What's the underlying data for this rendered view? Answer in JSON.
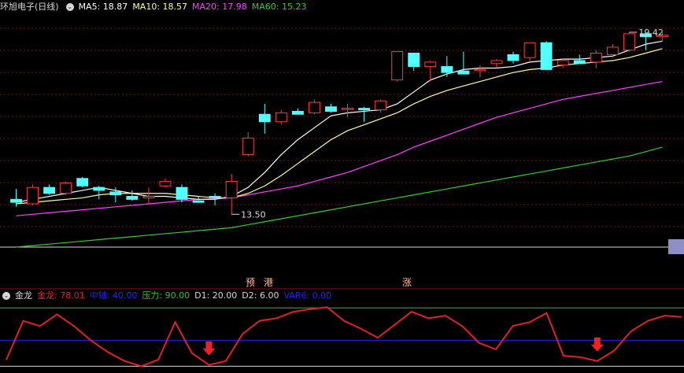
{
  "colors": {
    "bg": "#000000",
    "up": "#ff3b3b",
    "down": "#54ffff",
    "ma5": "#ffffff",
    "ma10": "#ffff99",
    "ma20": "#ff40ff",
    "ma60": "#33cc33",
    "gold": "#dd2222",
    "mid": "#2222ee",
    "press": "#33bb33",
    "grid": "#7a1414",
    "white": "#d8d8d8",
    "signal": "#ffb6a0"
  },
  "main_header": {
    "title": "环旭电子(日线)",
    "ma5": "MA5: 18.87",
    "ma10": "MA10: 18.57",
    "ma20": "MA20: 17.98",
    "ma60": "MA60: 15.23"
  },
  "ind_header": {
    "name": "金龙",
    "jinlong": "金龙: 78.01",
    "zhongzhou": "中轴: 40.00",
    "yali": "压力: 90.00",
    "d1": "D1: 20.00",
    "d2": "D2: 6.00",
    "var6": "VAR6: 0.00"
  },
  "signals": [
    "预",
    "港",
    "涨"
  ],
  "chart_data": [
    {
      "type": "candlestick",
      "title": "环旭电子(日线)",
      "y_range": [
        12.5,
        20.2
      ],
      "high_label": "19.42",
      "low_label": "13.50",
      "candles": [
        {
          "o": 14.1,
          "h": 14.45,
          "l": 13.85,
          "c": 14.0
        },
        {
          "o": 13.95,
          "h": 14.6,
          "l": 13.9,
          "c": 14.5
        },
        {
          "o": 14.5,
          "h": 14.6,
          "l": 14.25,
          "c": 14.3
        },
        {
          "o": 14.3,
          "h": 14.7,
          "l": 14.25,
          "c": 14.65
        },
        {
          "o": 14.8,
          "h": 14.85,
          "l": 14.5,
          "c": 14.55
        },
        {
          "o": 14.5,
          "h": 14.55,
          "l": 14.1,
          "c": 14.4
        },
        {
          "o": 14.35,
          "h": 14.5,
          "l": 14.0,
          "c": 14.25
        },
        {
          "o": 14.2,
          "h": 14.4,
          "l": 14.05,
          "c": 14.1
        },
        {
          "o": 14.15,
          "h": 14.5,
          "l": 13.95,
          "c": 14.2
        },
        {
          "o": 14.55,
          "h": 14.8,
          "l": 14.5,
          "c": 14.7
        },
        {
          "o": 14.5,
          "h": 14.6,
          "l": 14.0,
          "c": 14.1
        },
        {
          "o": 14.05,
          "h": 14.2,
          "l": 14.0,
          "c": 14.0
        },
        {
          "o": 14.2,
          "h": 14.3,
          "l": 13.9,
          "c": 14.15
        },
        {
          "o": 14.15,
          "h": 14.95,
          "l": 13.6,
          "c": 14.7
        },
        {
          "o": 15.6,
          "h": 16.35,
          "l": 15.55,
          "c": 16.15
        },
        {
          "o": 16.95,
          "h": 17.3,
          "l": 16.3,
          "c": 16.7
        },
        {
          "o": 16.7,
          "h": 17.1,
          "l": 16.6,
          "c": 17.0
        },
        {
          "o": 17.05,
          "h": 17.15,
          "l": 16.95,
          "c": 16.95
        },
        {
          "o": 17.0,
          "h": 17.45,
          "l": 16.95,
          "c": 17.35
        },
        {
          "o": 17.2,
          "h": 17.3,
          "l": 17.0,
          "c": 17.05
        },
        {
          "o": 17.15,
          "h": 17.3,
          "l": 16.85,
          "c": 17.15
        },
        {
          "o": 17.15,
          "h": 17.2,
          "l": 16.7,
          "c": 17.1
        },
        {
          "o": 17.1,
          "h": 17.45,
          "l": 17.0,
          "c": 17.4
        },
        {
          "o": 18.1,
          "h": 19.05,
          "l": 18.05,
          "c": 19.05
        },
        {
          "o": 19.0,
          "h": 19.0,
          "l": 18.4,
          "c": 18.55
        },
        {
          "o": 18.55,
          "h": 18.75,
          "l": 18.05,
          "c": 18.7
        },
        {
          "o": 18.55,
          "h": 18.9,
          "l": 18.2,
          "c": 18.35
        },
        {
          "o": 18.4,
          "h": 19.05,
          "l": 18.3,
          "c": 18.3
        },
        {
          "o": 18.45,
          "h": 18.6,
          "l": 18.2,
          "c": 18.45
        },
        {
          "o": 18.65,
          "h": 18.8,
          "l": 18.5,
          "c": 18.75
        },
        {
          "o": 18.95,
          "h": 19.05,
          "l": 18.65,
          "c": 18.75
        },
        {
          "o": 18.85,
          "h": 19.35,
          "l": 18.75,
          "c": 19.35
        },
        {
          "o": 19.35,
          "h": 19.4,
          "l": 18.45,
          "c": 18.45
        },
        {
          "o": 18.6,
          "h": 18.8,
          "l": 18.5,
          "c": 18.75
        },
        {
          "o": 18.75,
          "h": 18.95,
          "l": 18.65,
          "c": 18.65
        },
        {
          "o": 18.7,
          "h": 19.1,
          "l": 18.5,
          "c": 19.0
        },
        {
          "o": 18.95,
          "h": 19.3,
          "l": 18.85,
          "c": 19.2
        },
        {
          "o": 19.1,
          "h": 19.7,
          "l": 19.05,
          "c": 19.65
        },
        {
          "o": 19.65,
          "h": 19.7,
          "l": 19.1,
          "c": 19.55
        },
        {
          "o": 19.55,
          "h": 19.7,
          "l": 19.4,
          "c": 19.6
        }
      ],
      "ma5": [
        14.0,
        14.1,
        14.2,
        14.3,
        14.4,
        14.5,
        14.4,
        14.3,
        14.2,
        14.2,
        14.15,
        14.1,
        14.1,
        14.2,
        14.5,
        15.0,
        15.6,
        16.1,
        16.5,
        16.9,
        17.0,
        17.05,
        17.1,
        17.3,
        17.7,
        18.1,
        18.3,
        18.45,
        18.5,
        18.5,
        18.55,
        18.7,
        18.75,
        18.8,
        18.8,
        18.85,
        18.9,
        19.1,
        19.3,
        19.4
      ],
      "ma10": [
        13.95,
        14.0,
        14.05,
        14.1,
        14.15,
        14.25,
        14.3,
        14.3,
        14.3,
        14.3,
        14.25,
        14.2,
        14.15,
        14.15,
        14.3,
        14.55,
        14.9,
        15.3,
        15.7,
        16.1,
        16.4,
        16.6,
        16.8,
        17.0,
        17.3,
        17.55,
        17.75,
        17.9,
        18.05,
        18.2,
        18.35,
        18.45,
        18.5,
        18.6,
        18.65,
        18.7,
        18.75,
        18.85,
        19.0,
        19.15
      ],
      "ma20": [
        13.55,
        13.6,
        13.65,
        13.7,
        13.75,
        13.8,
        13.85,
        13.9,
        13.95,
        14.0,
        14.05,
        14.1,
        14.12,
        14.15,
        14.25,
        14.35,
        14.45,
        14.55,
        14.7,
        14.85,
        15.0,
        15.2,
        15.4,
        15.6,
        15.85,
        16.05,
        16.25,
        16.45,
        16.65,
        16.85,
        17.0,
        17.15,
        17.3,
        17.45,
        17.55,
        17.65,
        17.75,
        17.85,
        17.95,
        18.05
      ],
      "ma60": [
        12.5,
        12.55,
        12.6,
        12.65,
        12.7,
        12.75,
        12.8,
        12.85,
        12.9,
        12.95,
        13.0,
        13.05,
        13.1,
        13.15,
        13.25,
        13.35,
        13.45,
        13.55,
        13.65,
        13.75,
        13.85,
        13.95,
        14.05,
        14.15,
        14.25,
        14.35,
        14.45,
        14.55,
        14.65,
        14.75,
        14.85,
        14.95,
        15.05,
        15.15,
        15.25,
        15.35,
        15.45,
        15.55,
        15.7,
        15.85
      ]
    },
    {
      "type": "line",
      "title": "金龙",
      "y_range": [
        -2,
        100
      ],
      "series": [
        {
          "name": "金龙",
          "values": [
            10,
            70,
            62,
            80,
            62,
            40,
            22,
            8,
            0,
            10,
            68,
            20,
            2,
            8,
            50,
            70,
            74,
            84,
            88,
            91,
            70,
            58,
            44,
            64,
            84,
            74,
            78,
            62,
            36,
            26,
            62,
            68,
            82,
            16,
            14,
            8,
            24,
            54,
            70,
            78,
            76
          ]
        },
        {
          "name": "中轴",
          "values": [
            40
          ]
        },
        {
          "name": "压力",
          "values": [
            90
          ]
        }
      ],
      "arrows": [
        {
          "index": 12
        },
        {
          "index": 35
        }
      ]
    }
  ]
}
